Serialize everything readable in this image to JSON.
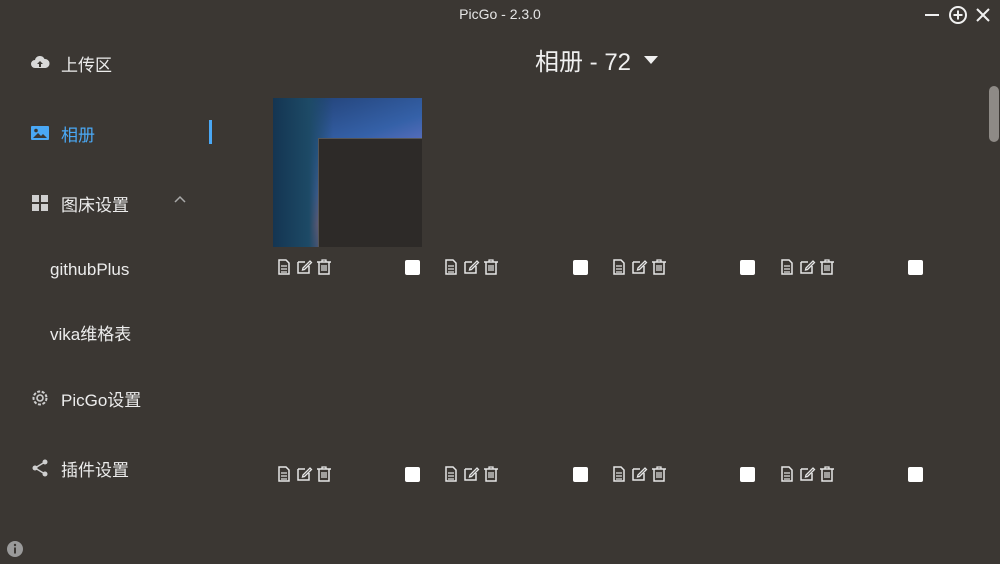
{
  "window": {
    "title": "PicGo - 2.3.0"
  },
  "sidebar": {
    "items": [
      {
        "label": "上传区",
        "icon": "cloud-upload-icon"
      },
      {
        "label": "相册",
        "icon": "image-icon",
        "active": true
      },
      {
        "label": "图床设置",
        "icon": "grid-icon"
      },
      {
        "label": "githubPlus"
      },
      {
        "label": "vika维格表"
      },
      {
        "label": "PicGo设置",
        "icon": "gear-icon"
      },
      {
        "label": "插件设置",
        "icon": "share-icon"
      }
    ]
  },
  "gallery": {
    "title": "相册 - 72",
    "items_count": 8
  },
  "colors": {
    "accent": "#4aa8f5",
    "background": "#3b3733"
  }
}
